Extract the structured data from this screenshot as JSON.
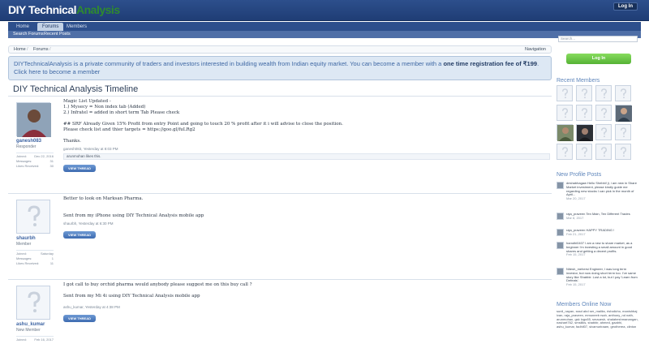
{
  "header": {
    "logo_part1": "DIY Technical",
    "logo_part2": "Analysis",
    "login_label": "Log In"
  },
  "nav": {
    "tabs": [
      "Home",
      "Forums",
      "Members"
    ],
    "subnav": [
      "Search Forums",
      "Recent Posts"
    ]
  },
  "breadcrumb": {
    "items": [
      "Home",
      "Forums"
    ],
    "navigation_label": "Navigation"
  },
  "notice": {
    "text": "DIYTechnicalAnalysis is a private community of traders and investors interested in building wealth from Indian equity market. You can become a member with a ",
    "bold": "one time registration fee of ₹199",
    "link": ". Click here to become a member"
  },
  "page": {
    "title": "DIY Technical Analysis Timeline"
  },
  "posts": [
    {
      "username": "ganesh083",
      "user_title": "Responder",
      "stats": [
        [
          "Joined:",
          "Dec 22, 2016"
        ],
        [
          "Messages:",
          "31"
        ],
        [
          "Likes Received:",
          "30"
        ]
      ],
      "body": "Magic List Updated -\n1.) Mysecy = Non index tab (Added)\n2.) Infratel = added in short term Tab Please check\n\n## SRF Already Given 15% Profit from entry Point and going to touch 20 % profit after it i will advise to close the position.\nPlease check list and thier targets = https://goo.gl/fuLRg2\n\nThanks.",
      "meta": "ganesh083, Yesterday at 8:03 PM",
      "reply": "arunmohan likes this.",
      "button": "VIEW THREAD"
    },
    {
      "username": "shaurbh",
      "user_title": "Member",
      "stats": [
        [
          "Joined:",
          "Saturday"
        ],
        [
          "Messages:",
          "1"
        ],
        [
          "Likes Received:",
          "11"
        ]
      ],
      "body": "Better to look on Marksan Pharma.\n\n\nSent from my iPhone using DIY Technical Analysis mobile app",
      "meta": "shaurbh, Yesterday at 6:30 PM",
      "button": "VIEW THREAD"
    },
    {
      "username": "ashu_kumar",
      "user_title": "New Member",
      "stats": [
        [
          "Joined:",
          "Feb 16, 2017"
        ]
      ],
      "body": "I got call to buy orchid pharma would anybody please suggest me on this buy call ?\n\nSent from my Mi 4i using DIY Technical Analysis mobile app",
      "meta": "ashu_kumar, Yesterday at 4:38 PM",
      "button": "VIEW THREAD"
    }
  ],
  "sidebar": {
    "search_placeholder": "Search...",
    "login_button": "Log In",
    "recent_members_heading": "Recent Members",
    "profile_posts_heading": "New Profile Posts",
    "profile_posts": [
      {
        "text": "deshabhagaw Hello Shebbi! ji, i am new in Share Market investment, please kindly guide me regarding new stocks I can pick in the month of April...",
        "date": "Mar 20, 2017"
      },
      {
        "text": "raja_praveen Ten Main, Ten Different Trades",
        "date": "Mar 8, 2017"
      },
      {
        "text": "raja_praveen HAPPY TRADING !",
        "date": "Feb 21, 2017"
      },
      {
        "text": "hamdhi0407 I am a new to share market, as a beginner i'm investing a small amount in good shares and getting a decent profits.",
        "date": "Feb 15, 2017"
      },
      {
        "text": "Nitesh_mehersi Engineer, I was long term investor, but now doing short term too. I've same story like Shabbir. Lost a lot, but I pay 'Learn from Defeats'.",
        "date": "Feb 15, 2017"
      }
    ],
    "online_heading": "Members Online Now",
    "online_text": "sunil_nayan, sssd abd ser_maliks, rishalicho, manishbaj ivan, raja_praveen, mmuneeb rsah, anthony_nd nath, arunmohan, gsk logu65, smauesh, shalaheshmanangan, nashart762, smsiliks, shabbir, ahmed, gaabhi, ashu_kumar, fadhil07, sivamuriraam, geotherea, clinton"
  }
}
